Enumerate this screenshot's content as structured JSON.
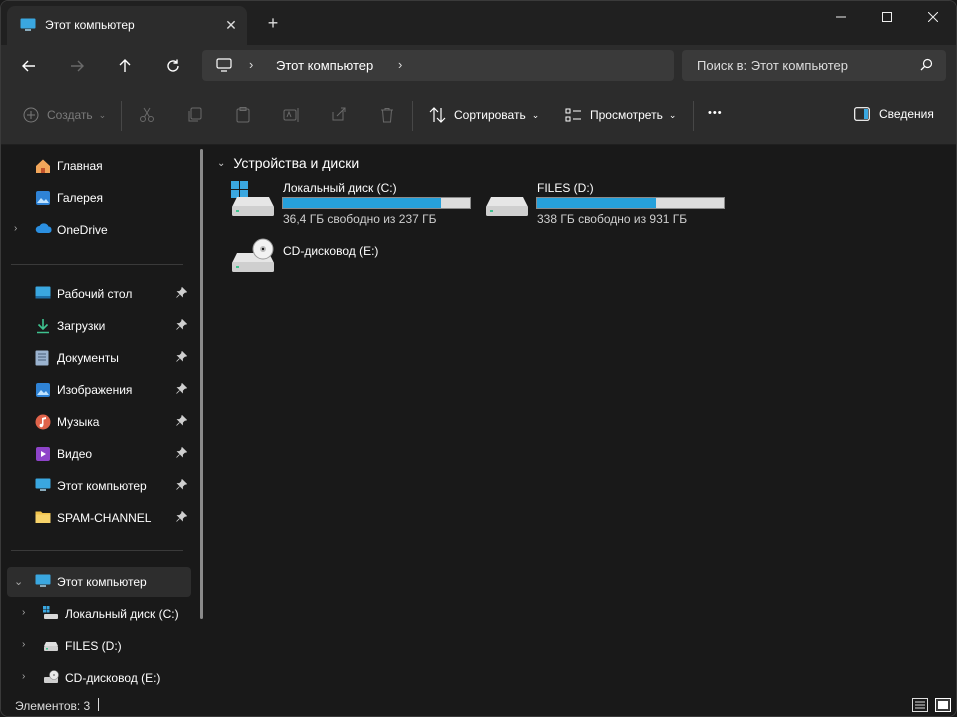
{
  "window": {
    "tab_title": "Этот компьютер",
    "close_tab": "✕",
    "new_tab": "+"
  },
  "nav": {
    "breadcrumb": "Этот компьютер",
    "search_placeholder": "Поиск в: Этот компьютер"
  },
  "toolbar": {
    "create": "Создать",
    "sort": "Сортировать",
    "view": "Просмотреть",
    "more": "•••",
    "details": "Сведения"
  },
  "sidebar": {
    "items": [
      {
        "label": "Главная"
      },
      {
        "label": "Галерея"
      },
      {
        "label": "OneDrive"
      },
      {
        "label": "Рабочий стол"
      },
      {
        "label": "Загрузки"
      },
      {
        "label": "Документы"
      },
      {
        "label": "Изображения"
      },
      {
        "label": "Музыка"
      },
      {
        "label": "Видео"
      },
      {
        "label": "Этот компьютер"
      },
      {
        "label": "SPAM-CHANNEL"
      },
      {
        "label": "Этот компьютер"
      },
      {
        "label": "Локальный диск (C:)"
      },
      {
        "label": "FILES (D:)"
      },
      {
        "label": "CD-дисковод (E:)"
      }
    ]
  },
  "main": {
    "group_title": "Устройства и диски",
    "drives": [
      {
        "name": "Локальный диск (C:)",
        "free_text": "36,4 ГБ свободно из 237 ГБ",
        "used_fraction": 0.847
      },
      {
        "name": "FILES (D:)",
        "free_text": "338 ГБ свободно из 931 ГБ",
        "used_fraction": 0.637
      },
      {
        "name": "CD-дисковод (E:)"
      }
    ]
  },
  "status": {
    "count": "Элементов: 3"
  },
  "colors": {
    "accent": "#26a0da",
    "window_bg": "#191919",
    "chrome_bg": "#2c2c2c"
  }
}
